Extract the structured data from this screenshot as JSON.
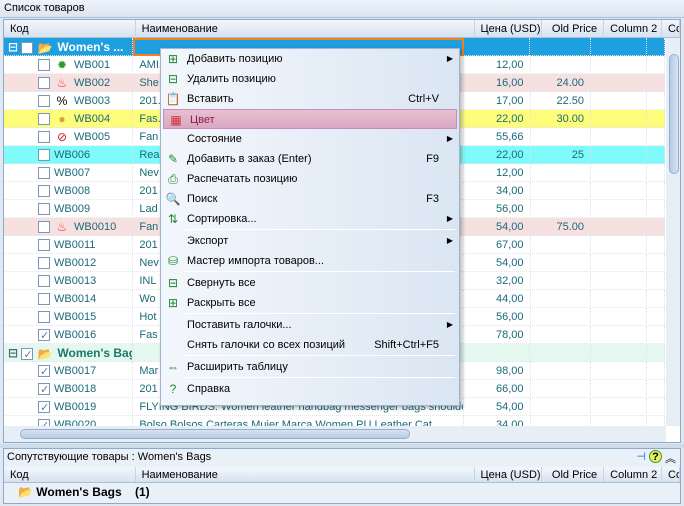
{
  "panel_title": "Список товаров",
  "columns": [
    "Код",
    "Наименование",
    "Цена (USD)",
    "Old Price",
    "Column 2",
    "Co"
  ],
  "rows": [
    {
      "type": "group",
      "code": "Women's ...",
      "name": "",
      "price": "",
      "old": "",
      "bg": "#1e9fe0",
      "icon": "folder-icon"
    },
    {
      "code": "WB001",
      "name": "AMI...",
      "price": "12,00",
      "old": "",
      "bg": "#ffffff",
      "icon": "alert-icon",
      "check": false
    },
    {
      "code": "WB002",
      "name": "She",
      "price": "16,00",
      "old": "24.00",
      "bg": "#f6e0e0",
      "icon": "fire-icon",
      "check": false
    },
    {
      "code": "WB003",
      "name": "201...d",
      "price": "17,00",
      "old": "22.50",
      "bg": "#ffffff",
      "icon": "percent-icon",
      "check": false
    },
    {
      "code": "WB004",
      "name": "Fas...",
      "price": "22,00",
      "old": "30.00",
      "bg": "#fdfd7a",
      "icon": "medal-icon",
      "check": false
    },
    {
      "code": "WB005",
      "name": "Fan",
      "price": "55,66",
      "old": "",
      "bg": "#ffffff",
      "icon": "forbidden-icon",
      "check": false
    },
    {
      "code": "WB006",
      "name": "Rea",
      "price": "22,00",
      "old": "25",
      "bg": "#80fbfb",
      "icon": "",
      "check": false
    },
    {
      "code": "WB007",
      "name": "Nev",
      "price": "12,00",
      "old": "",
      "bg": "#ffffff",
      "icon": "",
      "check": false
    },
    {
      "code": "WB008",
      "name": "201",
      "price": "34,00",
      "old": "",
      "bg": "#ffffff",
      "icon": "",
      "check": false
    },
    {
      "code": "WB009",
      "name": "Lad",
      "price": "56,00",
      "old": "",
      "bg": "#ffffff",
      "icon": "",
      "check": false
    },
    {
      "code": "WB0010",
      "name": "Fan",
      "price": "54,00",
      "old": "75.00",
      "bg": "#f6e0e0",
      "icon": "fire-icon",
      "check": false
    },
    {
      "code": "WB0011",
      "name": "201",
      "price": "67,00",
      "old": "",
      "bg": "#ffffff",
      "icon": "",
      "check": false
    },
    {
      "code": "WB0012",
      "name": "Nev",
      "price": "54,00",
      "old": "",
      "bg": "#ffffff",
      "icon": "",
      "check": false
    },
    {
      "code": "WB0013",
      "name": "INL",
      "price": "32,00",
      "old": "",
      "bg": "#ffffff",
      "icon": "",
      "check": false
    },
    {
      "code": "WB0014",
      "name": "Wo",
      "price": "44,00",
      "old": "",
      "bg": "#ffffff",
      "icon": "",
      "check": false
    },
    {
      "code": "WB0015",
      "name": "Hot",
      "price": "56,00",
      "old": "",
      "bg": "#ffffff",
      "icon": "",
      "check": false
    },
    {
      "code": "WB0016",
      "name": "Fas",
      "price": "78,00",
      "old": "",
      "bg": "#ffffff",
      "icon": "",
      "check": true
    },
    {
      "type": "group2",
      "code": "Women's Bags - M",
      "name": "",
      "price": "",
      "old": "",
      "bg": "#e4f8f0",
      "icon": "folder-icon",
      "check": true
    },
    {
      "code": "WB0017",
      "name": "Mar",
      "price": "98,00",
      "old": "",
      "bg": "#ffffff",
      "icon": "",
      "check": true
    },
    {
      "code": "WB0018",
      "name": "201",
      "price": "66,00",
      "old": "",
      "bg": "#ffffff",
      "icon": "",
      "check": true
    },
    {
      "code": "WB0019",
      "name": "FLYING BIRDS: Women leather handbag messenger bags shoulder",
      "price": "54,00",
      "old": "",
      "bg": "#ffffff",
      "icon": "",
      "check": true
    },
    {
      "code": "WB0020",
      "name": "Bolso Bolsos Carteras Mujer Marca Women PU Leather Cat",
      "price": "34,00",
      "old": "",
      "bg": "#ffffff",
      "icon": "",
      "check": true
    }
  ],
  "menu": [
    {
      "label": "Добавить позицию",
      "icon": "add-row-icon",
      "glyph": "⊞",
      "submenu": true
    },
    {
      "label": "Удалить позицию",
      "icon": "delete-row-icon",
      "glyph": "⊟"
    },
    {
      "label": "Вставить",
      "icon": "paste-icon",
      "glyph": "📋",
      "shortcut": "Ctrl+V"
    },
    {
      "label": "Цвет",
      "icon": "color-icon",
      "glyph": "▦",
      "highlight": true
    },
    {
      "label": "Состояние",
      "submenu": true
    },
    {
      "label": "Добавить в заказ   (Enter)",
      "icon": "order-icon",
      "glyph": "✎",
      "shortcut": "F9"
    },
    {
      "label": "Распечатать позицию",
      "icon": "print-icon",
      "glyph": "⎙"
    },
    {
      "label": "Поиск",
      "icon": "search-icon",
      "glyph": "🔍",
      "shortcut": "F3"
    },
    {
      "label": "Сортировка...",
      "icon": "sort-icon",
      "glyph": "⇅",
      "submenu": true,
      "sep": true
    },
    {
      "label": "Экспорт",
      "submenu": true
    },
    {
      "label": "Мастер импорта товаров...",
      "icon": "import-icon",
      "glyph": "⛁",
      "sep": true
    },
    {
      "label": "Свернуть все",
      "icon": "collapse-icon",
      "glyph": "⊟"
    },
    {
      "label": "Раскрыть все",
      "icon": "expand-icon",
      "glyph": "⊞",
      "sep": true
    },
    {
      "label": "Поставить галочки...",
      "submenu": true
    },
    {
      "label": "Снять галочки со всех позиций",
      "shortcut": "Shift+Ctrl+F5",
      "sep": true
    },
    {
      "label": "Расширить таблицу",
      "icon": "widen-table-icon",
      "glyph": "⇔",
      "sep": true
    },
    {
      "label": "Справка",
      "icon": "help-icon",
      "glyph": "?"
    }
  ],
  "bottom": {
    "title": "Сопутствующие товары : Women's Bags",
    "columns": [
      "Код",
      "Наименование",
      "Цена (USD)",
      "Old Price",
      "Column 2",
      "Co"
    ],
    "group": "Women's Bags",
    "count": "(1)"
  }
}
